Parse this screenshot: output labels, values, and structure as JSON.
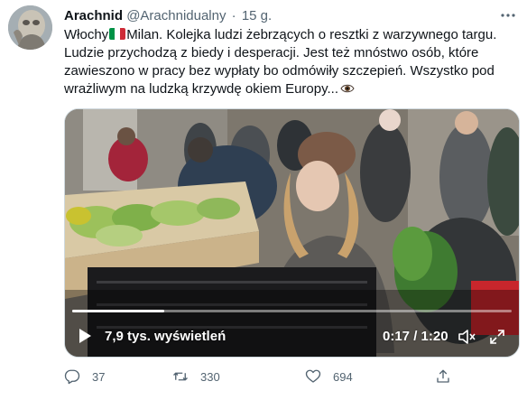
{
  "tweet": {
    "author_name": "Arachnid",
    "handle": "@Arachnidualny",
    "separator": "·",
    "time": "15 g.",
    "text_lines": [
      "Włochy",
      "Milan. Kolejka ludzi żebrzących o resztki z warzywnego targu.",
      "Ludzie przychodzą z biedy i desperacji. Jest też mnóstwo osób, które",
      "zawieszono w pracy bez wypłaty bo odmówiły szczepień. Wszystko pod",
      "wrażliwym na ludzką krzywdę okiem Europy..."
    ],
    "flag_icon": "italy-flag-icon",
    "eye_icon": "eye-icon"
  },
  "video": {
    "views": "7,9 tys. wyświetleń",
    "timecode": "0:17 / 1:20",
    "progress": 0.21
  },
  "actions": {
    "reply_count": "37",
    "retweet_count": "330",
    "like_count": "694"
  },
  "colors": {
    "text": "#0f1419",
    "secondary": "#536471",
    "border": "#cfd9de",
    "flag_green": "#009246",
    "flag_white": "#ffffff",
    "flag_red": "#ce2b37"
  }
}
